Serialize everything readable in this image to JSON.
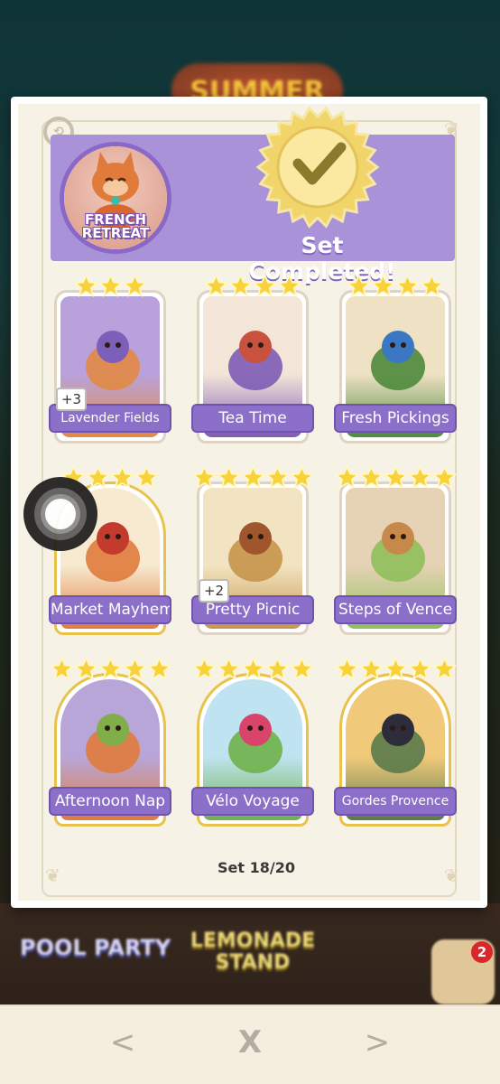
{
  "background": {
    "event_title": "SUMMER",
    "left_board_label": "POOL PARTY",
    "center_board_label": "LEMONADE\nSTAND",
    "notification_count": "2"
  },
  "album": {
    "set_name": "FRENCH\nRETREAT",
    "status": "Set Completed!",
    "set_progress": "Set 18/20",
    "cards": [
      {
        "name": "Lavender Fields",
        "stars": 3,
        "gold": false,
        "duplicates": "+3"
      },
      {
        "name": "Tea Time",
        "stars": 4,
        "gold": false,
        "duplicates": ""
      },
      {
        "name": "Fresh Pickings",
        "stars": 4,
        "gold": false,
        "duplicates": ""
      },
      {
        "name": "Market Mayhem",
        "stars": 4,
        "gold": true,
        "duplicates": ""
      },
      {
        "name": "Pretty Picnic",
        "stars": 5,
        "gold": false,
        "duplicates": "+2"
      },
      {
        "name": "Steps of Vence",
        "stars": 5,
        "gold": false,
        "duplicates": ""
      },
      {
        "name": "Afternoon Nap",
        "stars": 5,
        "gold": true,
        "duplicates": ""
      },
      {
        "name": "Vélo Voyage",
        "stars": 5,
        "gold": true,
        "duplicates": ""
      },
      {
        "name": "Gordes Provence",
        "stars": 5,
        "gold": true,
        "duplicates": ""
      }
    ]
  },
  "nav": {
    "prev": "<",
    "close": "X",
    "next": ">"
  },
  "colors": {
    "album_purple": "#a992d8",
    "label_purple": "#8b6fc8",
    "star_yellow": "#f7d23a",
    "gold_frame": "#e8c24a"
  }
}
